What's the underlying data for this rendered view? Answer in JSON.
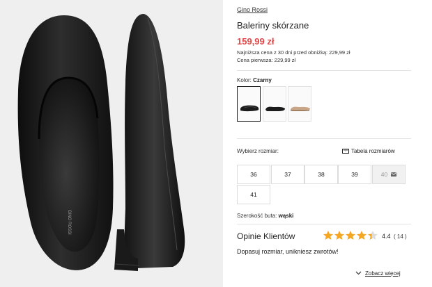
{
  "product": {
    "brand": "Gino Rossi",
    "title": "Baleriny skórzane",
    "price": "159,99 zł",
    "lowest_price_note": "Najniższa cena z 30 dni przed obniżką: 229,99 zł",
    "original_price_note": "Cena pierwsza: 229,99 zł",
    "image_imprint": "GINO ROSSI"
  },
  "color": {
    "label": "Kolor:",
    "value": "Czarny",
    "swatches": [
      {
        "name": "black-front",
        "color": "#1b1b1b",
        "selected": true
      },
      {
        "name": "black-side",
        "color": "#1b1b1b",
        "selected": false
      },
      {
        "name": "beige-side",
        "color": "#c9a688",
        "selected": false
      }
    ]
  },
  "size": {
    "label": "Wybierz rozmiar:",
    "guide_label": "Tabela rozmiarów",
    "options": [
      {
        "value": "36",
        "available": true
      },
      {
        "value": "37",
        "available": true
      },
      {
        "value": "38",
        "available": true
      },
      {
        "value": "39",
        "available": true
      },
      {
        "value": "40",
        "available": false
      },
      {
        "value": "41",
        "available": true
      }
    ]
  },
  "shoe_width": {
    "label": "Szerokość buta:",
    "value": "wąski"
  },
  "reviews": {
    "title": "Opinie Klientów",
    "rating": "4.4",
    "rating_value": 4.4,
    "count": "( 14 )",
    "star_color": "#f5a623",
    "first_review": "Dopasuj rozmiar, unikniesz zwrotów!",
    "see_more_label": "Zobacz więcej"
  }
}
